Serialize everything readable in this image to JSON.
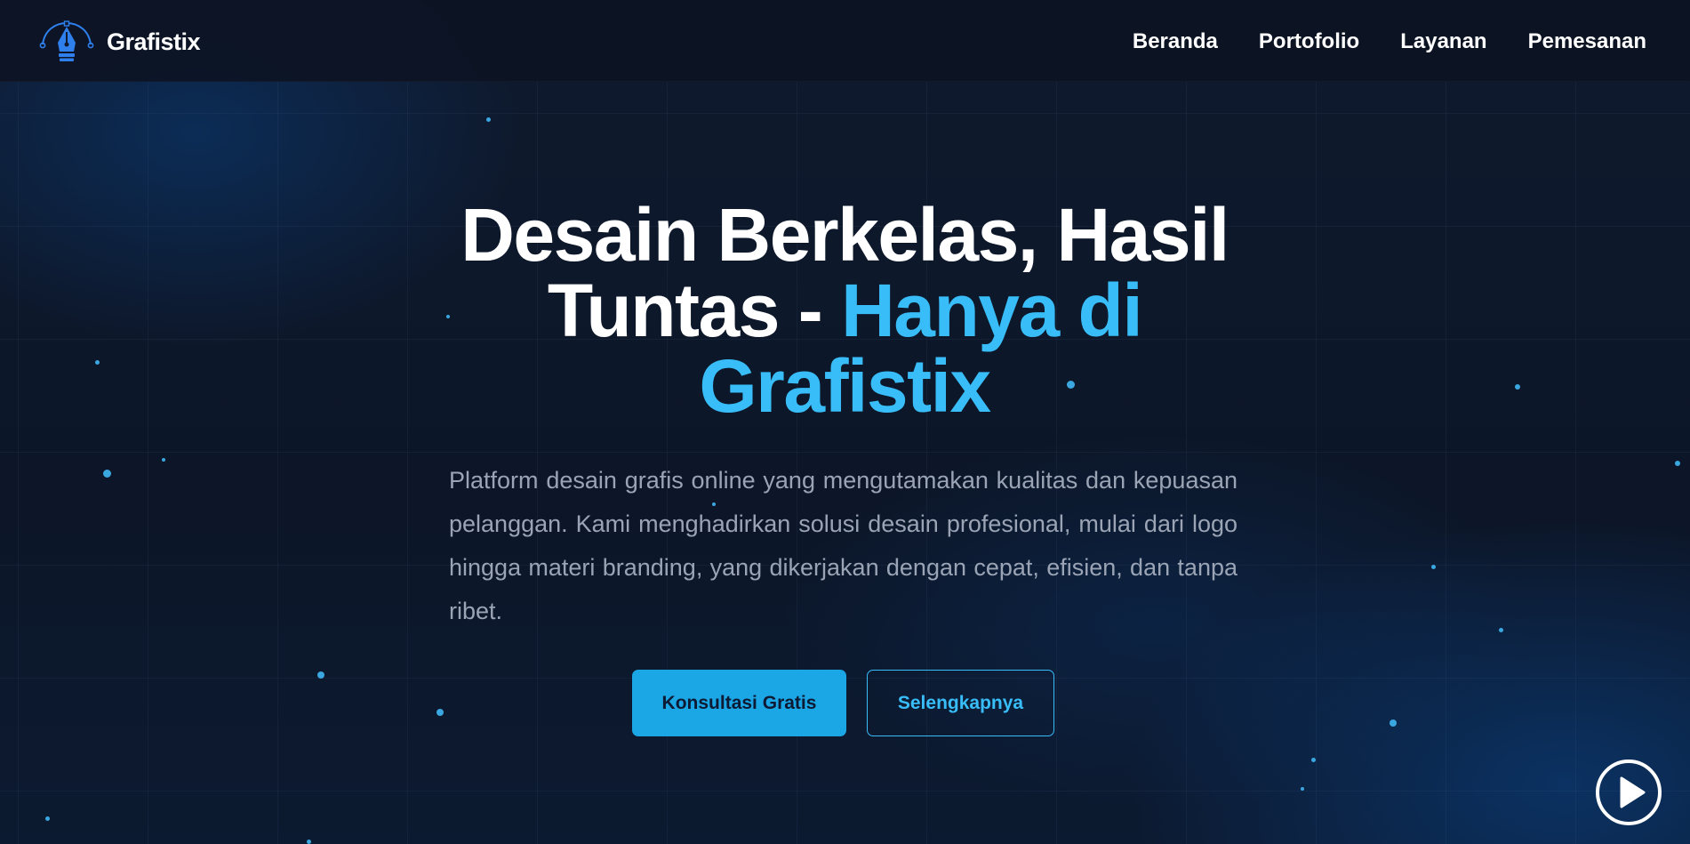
{
  "brand": {
    "name": "Grafistix",
    "icon": "pen-nib-icon"
  },
  "nav": {
    "items": [
      {
        "label": "Beranda"
      },
      {
        "label": "Portofolio"
      },
      {
        "label": "Layanan"
      },
      {
        "label": "Pemesanan"
      }
    ]
  },
  "hero": {
    "title_line1": "Desain Berkelas, Hasil",
    "title_line2_plain": "Tuntas - ",
    "title_line2_accent": "Hanya di",
    "title_line3_accent": "Grafistix",
    "description": "Platform desain grafis online yang mengutamakan kualitas dan kepuasan pelanggan. Kami menghadirkan solusi desain profesional, mulai dari logo hingga materi branding, yang dikerjakan dengan cepat, efisien, dan tanpa ribet.",
    "primary_button": "Konsultasi Gratis",
    "secondary_button": "Selengkapnya"
  },
  "play_button": {
    "icon": "play-icon"
  },
  "colors": {
    "accent": "#38bdf8",
    "primary_button_bg": "#1ba6e6",
    "background": "#0d1526",
    "text_muted": "#9aa4b5"
  }
}
